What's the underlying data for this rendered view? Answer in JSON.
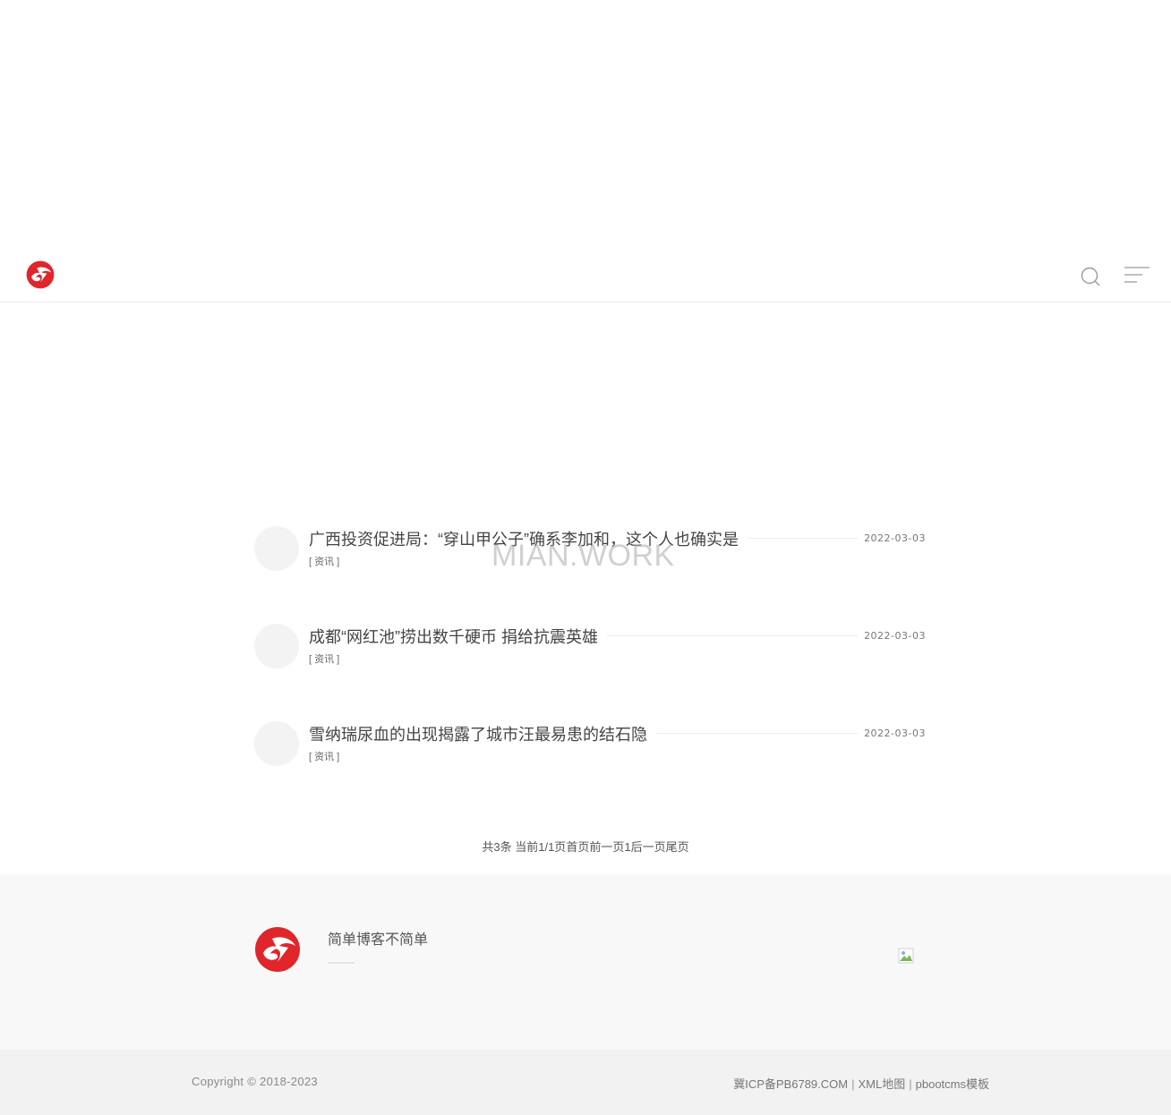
{
  "colors": {
    "brand": "#e0262b",
    "text": "#444444",
    "muted": "#777777",
    "line": "#ececec"
  },
  "header": {
    "logo": "brand-logo",
    "search_icon": "search-icon",
    "menu_icon": "menu-icon"
  },
  "articles": [
    {
      "title": "广西投资促进局：“穿山甲公子”确系李加和，这个人也确实是",
      "category": "[ 资讯 ]",
      "date": "2022-03-03"
    },
    {
      "title": "成都“网红池”捞出数千硬币 捐给抗震英雄",
      "category": "[ 资讯 ]",
      "date": "2022-03-03"
    },
    {
      "title": "雪纳瑞尿血的出现揭露了城市汪最易患的结石隐",
      "category": "[ 资讯 ]",
      "date": "2022-03-03"
    }
  ],
  "watermark": "MIAN.WORK",
  "pagination": {
    "total": "共3条",
    "current": "当前1/1页",
    "first": "首页",
    "prev": "前一页",
    "page1": "1",
    "next": "后一页",
    "last": "尾页"
  },
  "footer": {
    "slogan": "简单博客不简单",
    "copyright": "Copyright © 2018-2023",
    "icp": "冀ICP备PB6789.COM",
    "sitemap": "XML地图",
    "template": "pbootcms模板",
    "separator": "|"
  }
}
